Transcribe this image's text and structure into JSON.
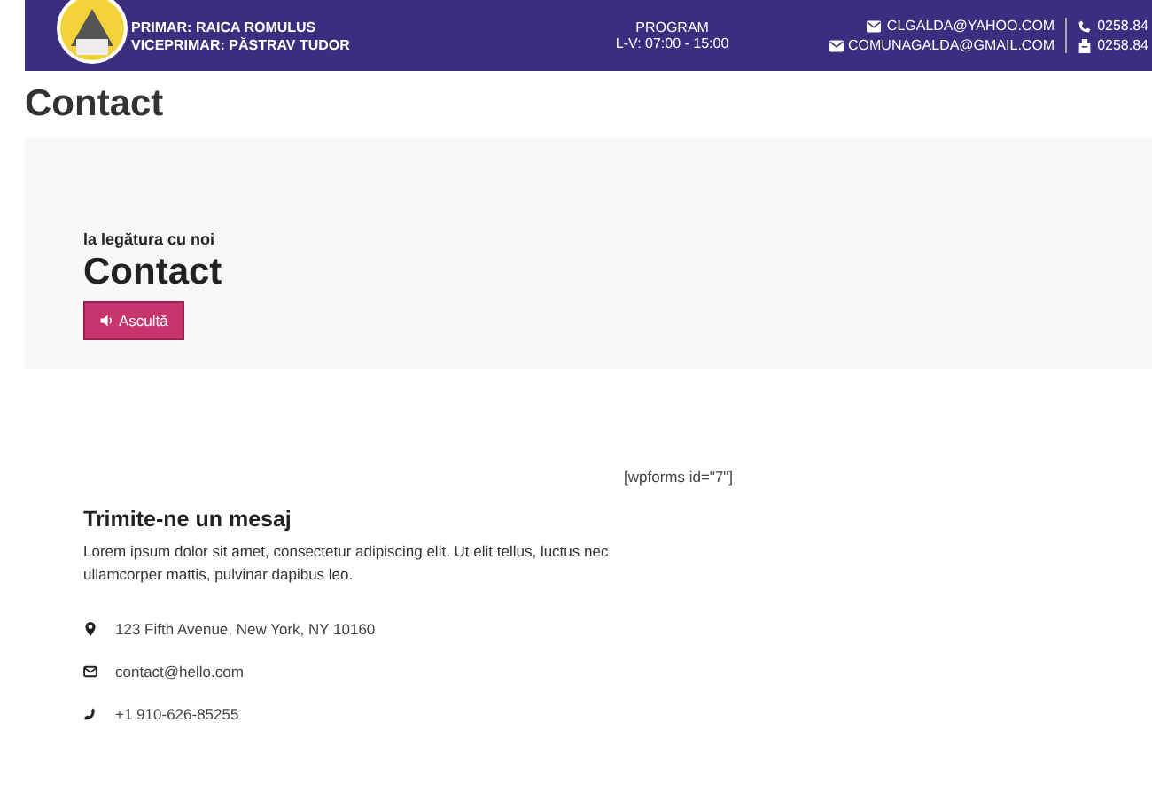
{
  "header": {
    "officials": [
      "PRIMAR: RAICA ROMULUS",
      "VICEPRIMAR: PĂSTRAV TUDOR"
    ],
    "program": {
      "title": "PROGRAM",
      "hours": "L-V: 07:00 - 15:00"
    },
    "emails": [
      "CLGALDA@YAHOO.COM",
      "COMUNAGALDA@GMAIL.COM"
    ],
    "phones": [
      {
        "kind": "phone",
        "text": "0258.84"
      },
      {
        "kind": "fax",
        "text": "0258.84"
      }
    ]
  },
  "page_title": "Contact",
  "hero": {
    "subtitle": "la legătura cu noi",
    "title": "Contact",
    "listen_button": "Ascultă"
  },
  "shortcode": "[wpforms id=\"7\"]",
  "message": {
    "title": "Trimite-ne un mesaj",
    "text": "Lorem ipsum dolor sit amet, consectetur adipiscing elit. Ut elit tellus, luctus nec ullamcorper mattis, pulvinar dapibus leo.",
    "contacts": [
      {
        "kind": "address",
        "text": "123 Fifth Avenue, New York, NY 10160"
      },
      {
        "kind": "email",
        "text": "contact@hello.com"
      },
      {
        "kind": "phone",
        "text": "+1 910-626-85255"
      }
    ]
  }
}
